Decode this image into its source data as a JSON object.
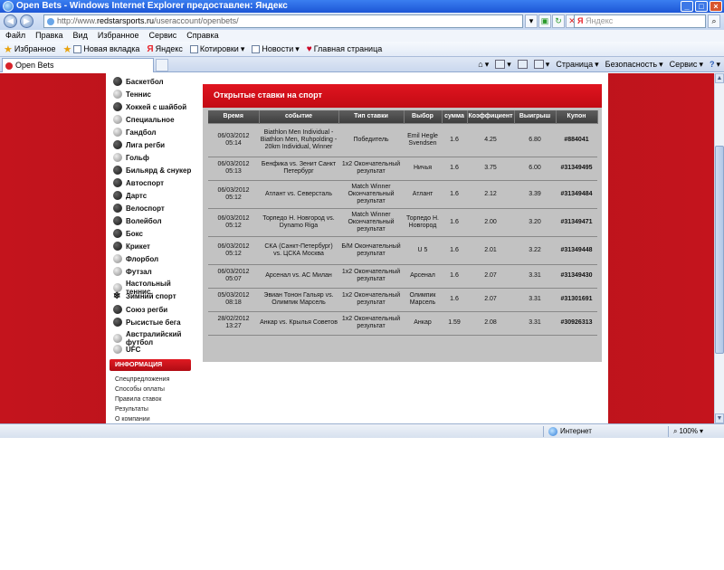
{
  "window": {
    "title": "Open Bets - Windows Internet Explorer предоставлен: Яндекс",
    "controls": [
      "_",
      "□",
      "×"
    ]
  },
  "address": {
    "url_prefix": "http://www.",
    "url_host": "redstarsports.ru",
    "url_path": "/useraccount/openbets/",
    "search_placeholder": "Яндекс"
  },
  "menu": [
    "Файл",
    "Правка",
    "Вид",
    "Избранное",
    "Сервис",
    "Справка"
  ],
  "favorites": {
    "label": "Избранное",
    "items": [
      "Новая вкладка",
      "Яндекс",
      "Котировки",
      "Новости",
      "Главная страница"
    ]
  },
  "tab": {
    "title": "Open Bets"
  },
  "commands": [
    "Страница",
    "Безопасность",
    "Сервис"
  ],
  "sports": [
    {
      "name": "Баскетбол",
      "icon": "basketball-icon"
    },
    {
      "name": "Теннис",
      "icon": "tennis-icon"
    },
    {
      "name": "Хоккей с шайбой",
      "icon": "hockey-puck-icon"
    },
    {
      "name": "Специальное",
      "icon": "special-icon"
    },
    {
      "name": "Гандбол",
      "icon": "handball-icon"
    },
    {
      "name": "Лига регби",
      "icon": "rugby-ball-icon"
    },
    {
      "name": "Гольф",
      "icon": "golf-ball-icon"
    },
    {
      "name": "Бильярд & снукер",
      "icon": "billiard-ball-icon"
    },
    {
      "name": "Автоспорт",
      "icon": "steering-wheel-icon"
    },
    {
      "name": "Дартс",
      "icon": "dartboard-icon"
    },
    {
      "name": "Велоспорт",
      "icon": "cycling-icon"
    },
    {
      "name": "Волейбол",
      "icon": "volleyball-icon"
    },
    {
      "name": "Бокс",
      "icon": "boxing-glove-icon"
    },
    {
      "name": "Крикет",
      "icon": "cricket-ball-icon"
    },
    {
      "name": "Флорбол",
      "icon": "floorball-icon"
    },
    {
      "name": "Футзал",
      "icon": "futsal-ball-icon"
    },
    {
      "name": "Настольный теннис",
      "icon": "table-tennis-icon"
    },
    {
      "name": "Зимний спорт",
      "icon": "snowflake-icon"
    },
    {
      "name": "Союз регби",
      "icon": "rugby-union-icon"
    },
    {
      "name": "Рысистые бега",
      "icon": "horse-icon"
    },
    {
      "name": "Австралийский футбол",
      "icon": "aussie-football-icon"
    },
    {
      "name": "UFC",
      "icon": "ufc-icon"
    }
  ],
  "info": {
    "heading": "ИНФОРМАЦИЯ",
    "links": [
      "Спецпредложения",
      "Способы оплаты",
      "Правила ставок",
      "Результаты",
      "О компании"
    ]
  },
  "bets": {
    "title": "Открытые ставки на спорт",
    "columns": [
      "Время",
      "событие",
      "Тип ставки",
      "Выбор",
      "сумма",
      "Коэффициент",
      "Выигрыш",
      "Купон"
    ],
    "rows": [
      {
        "time": "06/03/2012 05:14",
        "event": "Biathlon Men Individual - Biathlon Men, Ruhpolding - 20km Individual, Winner",
        "type": "Победитель",
        "choice": "Emil Hegle Svendsen",
        "stake": "1.6",
        "odds": "4.25",
        "win": "6.80",
        "coupon": "#884041"
      },
      {
        "time": "06/03/2012 05:13",
        "event": "Бенфика vs. Зенит Санкт Петербург",
        "type": "1x2 Окончательный результат",
        "choice": "Ничья",
        "stake": "1.6",
        "odds": "3.75",
        "win": "6.00",
        "coupon": "#31349495"
      },
      {
        "time": "06/03/2012 05:12",
        "event": "Атлант vs. Северсталь",
        "type": "Match Winner Окончательный результат",
        "choice": "Атлант",
        "stake": "1.6",
        "odds": "2.12",
        "win": "3.39",
        "coupon": "#31349484"
      },
      {
        "time": "06/03/2012 05:12",
        "event": "Торпедо Н. Новгород vs. Dynamo Riga",
        "type": "Match Winner Окончательный результат",
        "choice": "Торпедо Н. Новгород",
        "stake": "1.6",
        "odds": "2.00",
        "win": "3.20",
        "coupon": "#31349471"
      },
      {
        "time": "06/03/2012 05:12",
        "event": "СКА (Санкт-Петербург) vs. ЦСКА Москва",
        "type": "Б/М Окончательный результат",
        "choice": "U 5",
        "stake": "1.6",
        "odds": "2.01",
        "win": "3.22",
        "coupon": "#31349448"
      },
      {
        "time": "06/03/2012 05:07",
        "event": "Арсенал vs. AC Милан",
        "type": "1x2 Окончательный результат",
        "choice": "Арсенал",
        "stake": "1.6",
        "odds": "2.07",
        "win": "3.31",
        "coupon": "#31349430"
      },
      {
        "time": "05/03/2012 08:18",
        "event": "Эвиан Тонон Гальяр vs. Олимпик Марсель",
        "type": "1x2 Окончательный результат",
        "choice": "Олимпик Марсель",
        "stake": "1.6",
        "odds": "2.07",
        "win": "3.31",
        "coupon": "#31301691"
      },
      {
        "time": "28/02/2012 13:27",
        "event": "Анкар vs. Крылья Советов",
        "type": "1x2 Окончательный результат",
        "choice": "Анкар",
        "stake": "1.59",
        "odds": "2.08",
        "win": "3.31",
        "coupon": "#30926313"
      }
    ]
  },
  "status": {
    "zone": "Интернет",
    "zoom": "100%"
  },
  "colors": {
    "brand_red": "#c4141d",
    "header_dark": "#3e3e3e",
    "panel_gray": "#c2c2c2"
  }
}
